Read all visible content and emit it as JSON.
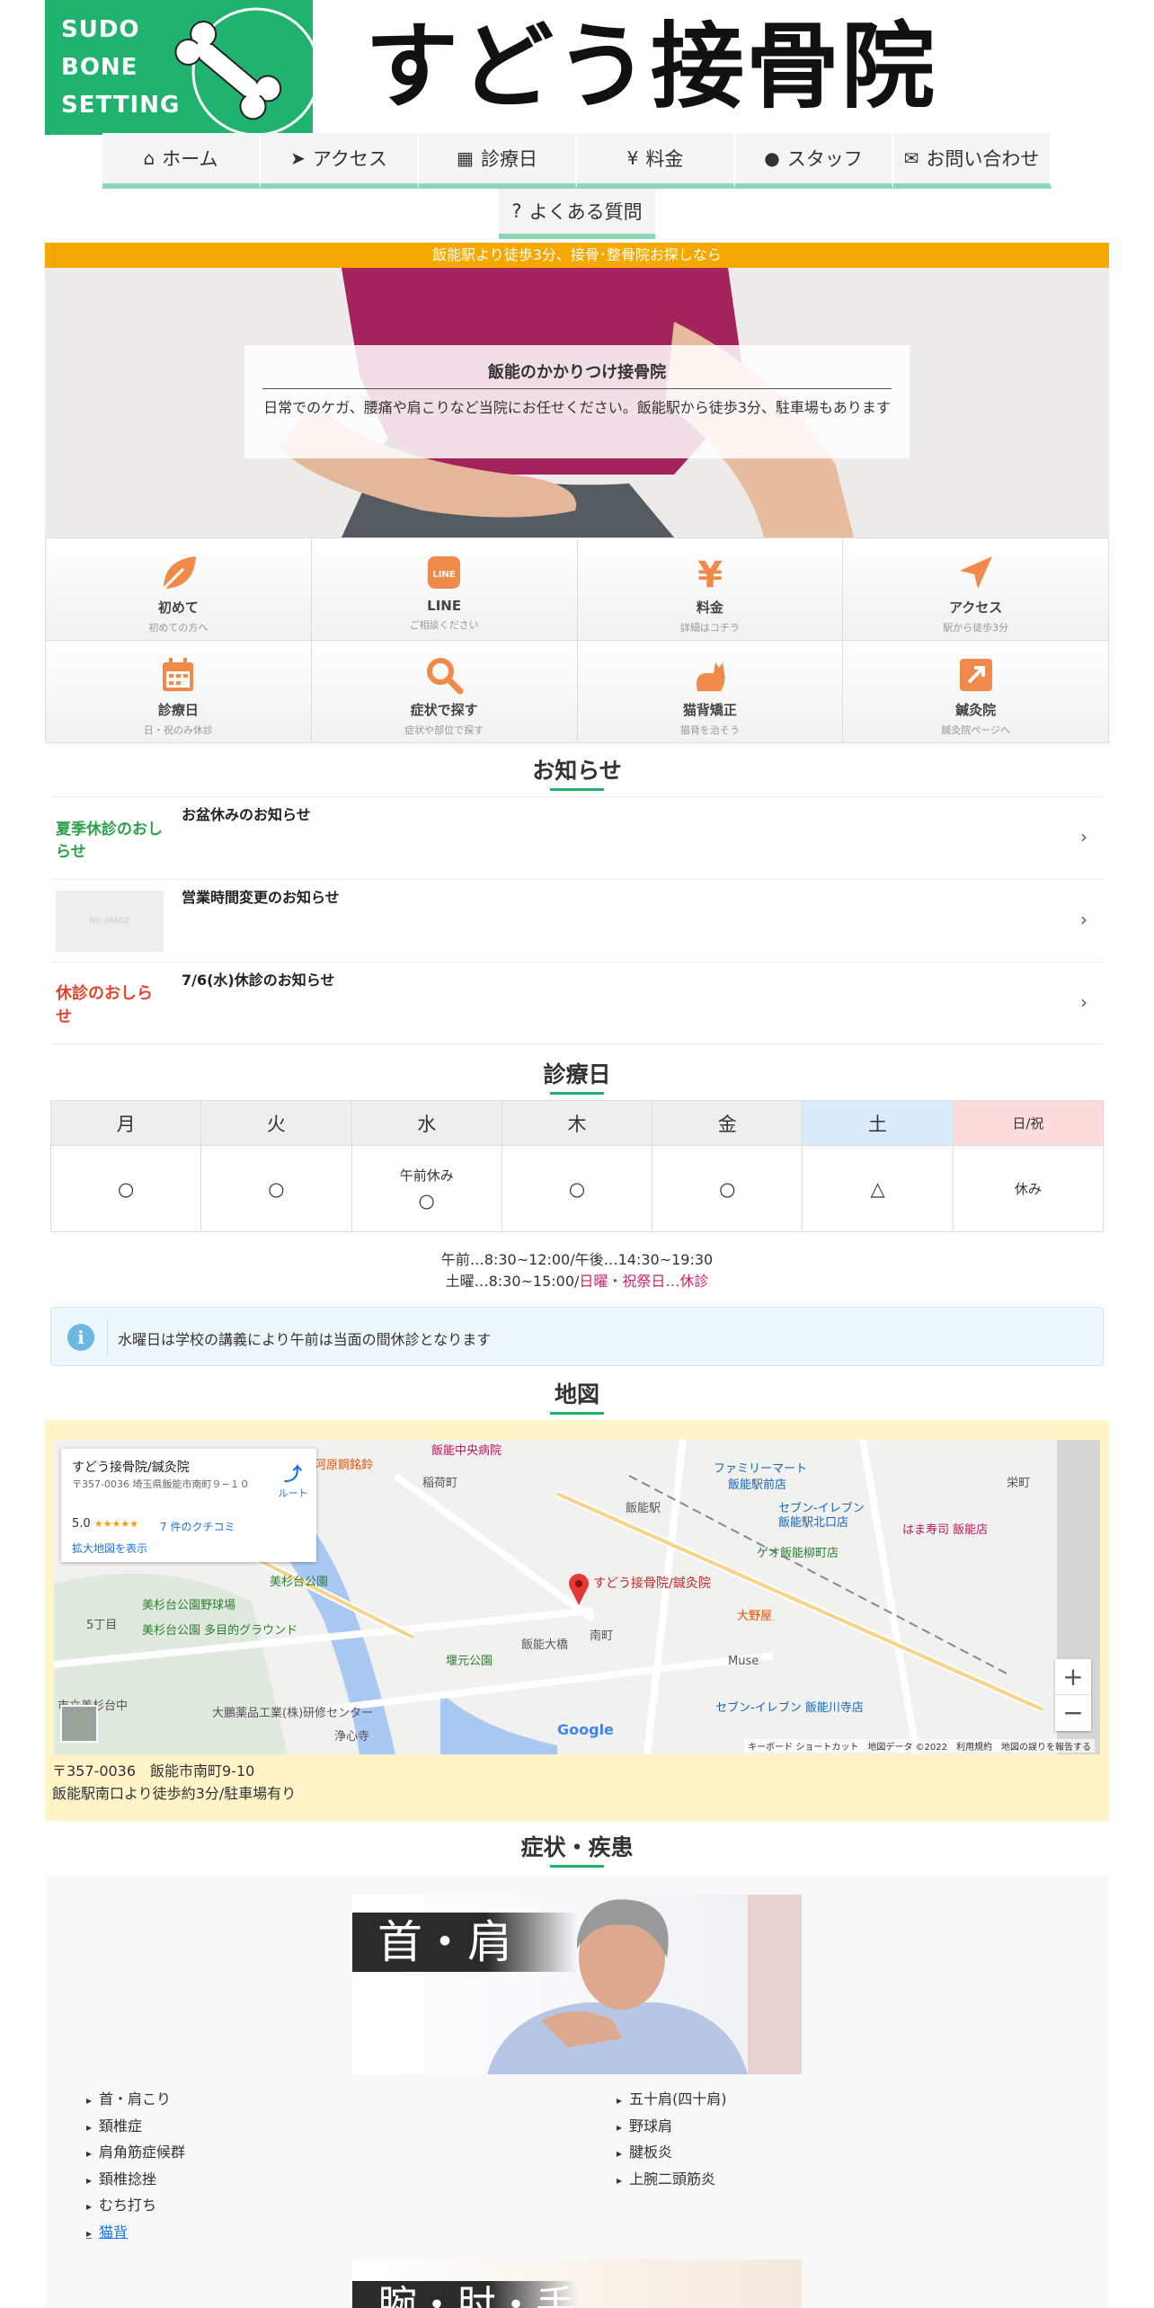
{
  "header": {
    "logo_lines": [
      "SUDO",
      "BONE",
      "SETTING"
    ],
    "site_title": "すどう接骨院"
  },
  "nav": {
    "items": [
      {
        "icon": "home-icon",
        "label": "ホーム"
      },
      {
        "icon": "location-arrow-icon",
        "label": "アクセス"
      },
      {
        "icon": "calendar-icon",
        "label": "診療日"
      },
      {
        "icon": "yen-icon",
        "label": "料金"
      },
      {
        "icon": "user-icon",
        "label": "スタッフ"
      },
      {
        "icon": "envelope-icon",
        "label": "お問い合わせ"
      }
    ],
    "faq": "よくある質問"
  },
  "banner": "飯能駅より徒歩3分、接骨･整骨院お探しなら",
  "hero": {
    "title": "飯能のかかりつけ接骨院",
    "text": "日常でのケガ、腰痛や肩こりなど当院にお任せください。飯能駅から徒歩3分、駐車場もあります"
  },
  "menu": [
    {
      "icon": "leaf-icon",
      "label": "初めて",
      "sub": "初めての方へ"
    },
    {
      "icon": "line-icon",
      "icon_text": "LINE",
      "label": "LINE",
      "sub": "ご相談ください"
    },
    {
      "icon": "yen-icon",
      "label": "料金",
      "sub": "詳細はコチラ"
    },
    {
      "icon": "location-arrow-icon",
      "label": "アクセス",
      "sub": "駅から徒歩3分"
    },
    {
      "icon": "calendar-icon",
      "label": "診療日",
      "sub": "日・祝のみ休診"
    },
    {
      "icon": "search-icon",
      "label": "症状で探す",
      "sub": "症状や部位で探す"
    },
    {
      "icon": "cat-icon",
      "label": "猫背矯正",
      "sub": "猫背を治そう"
    },
    {
      "icon": "external-link-icon",
      "label": "鍼灸院",
      "sub": "鍼灸院ページへ"
    }
  ],
  "news": {
    "heading": "お知らせ",
    "items": [
      {
        "thumb": "夏季休診のおしらせ",
        "title": "お盆休みのお知らせ"
      },
      {
        "thumb": "NO IMAGE",
        "title": "営業時間変更のお知らせ"
      },
      {
        "thumb": "休診のおしらせ",
        "title": "7/6(水)休診のお知らせ"
      }
    ]
  },
  "schedule": {
    "heading": "診療日",
    "days": [
      "月",
      "火",
      "水",
      "木",
      "金",
      "土",
      "日/祝"
    ],
    "marks": [
      "○",
      "○",
      "○",
      "○",
      "○",
      "△",
      "休み"
    ],
    "wed_note": "午前休み",
    "hours_line1": "午前…8:30~12:00/午後…14:30~19:30",
    "hours_line2_pre": "土曜…8:30~15:00/",
    "hours_line2_red": "日曜・祝祭日…休診",
    "notice": "水曜日は学校の講義により午前は当面の間休診となります"
  },
  "map": {
    "heading": "地図",
    "card_name": "すどう接骨院/鍼灸院",
    "card_addr": "〒357-0036 埼玉県飯能市南町９−１０",
    "rating": "5.0",
    "stars": "★★★★★",
    "reviews": "7 件のクチコミ",
    "large_map": "拡大地図を表示",
    "route": "ルート",
    "pin_label": "すどう接骨院/鍼灸院",
    "places": [
      "飯能中央病院",
      "稲荷町",
      "ファミリーマート",
      "飯能駅前店",
      "飯能駅",
      "セブン-イレブン",
      "飯能駅北口店",
      "栄町",
      "はま寿司 飯能店",
      "ゲオ飯能柳町店",
      "美杉台公園",
      "美杉台公園野球場",
      "美杉台公園 多目的グラウンド",
      "5丁目",
      "大野屋",
      "南町",
      "飯能大橋",
      "堰元公園",
      "Muse",
      "セブン-イレブン 飯能川寺店",
      "大鵬薬品工業(株)研修センター",
      "浄心寺",
      "市立美杉台中",
      "河原鋼銘鈴"
    ],
    "footer": "キーボード ショートカット　地図データ ©2022　利用規約　地図の誤りを報告する",
    "google": "Google",
    "addr_line1": "〒357-0036　飯能市南町9-10",
    "addr_line2": "飯能駅南口より徒歩約3分/駐車場有り"
  },
  "symptoms": {
    "heading": "症状・疾患",
    "image_label": "首・肩",
    "left": [
      "首・肩こり",
      "頚椎症",
      "肩角筋症候群",
      "頚椎捻挫",
      "むち打ち",
      "猫背"
    ],
    "right": [
      "五十肩(四十肩)",
      "野球肩",
      "腱板炎",
      "上腕二頭筋炎"
    ],
    "image2_label": "腕・肘・手"
  }
}
